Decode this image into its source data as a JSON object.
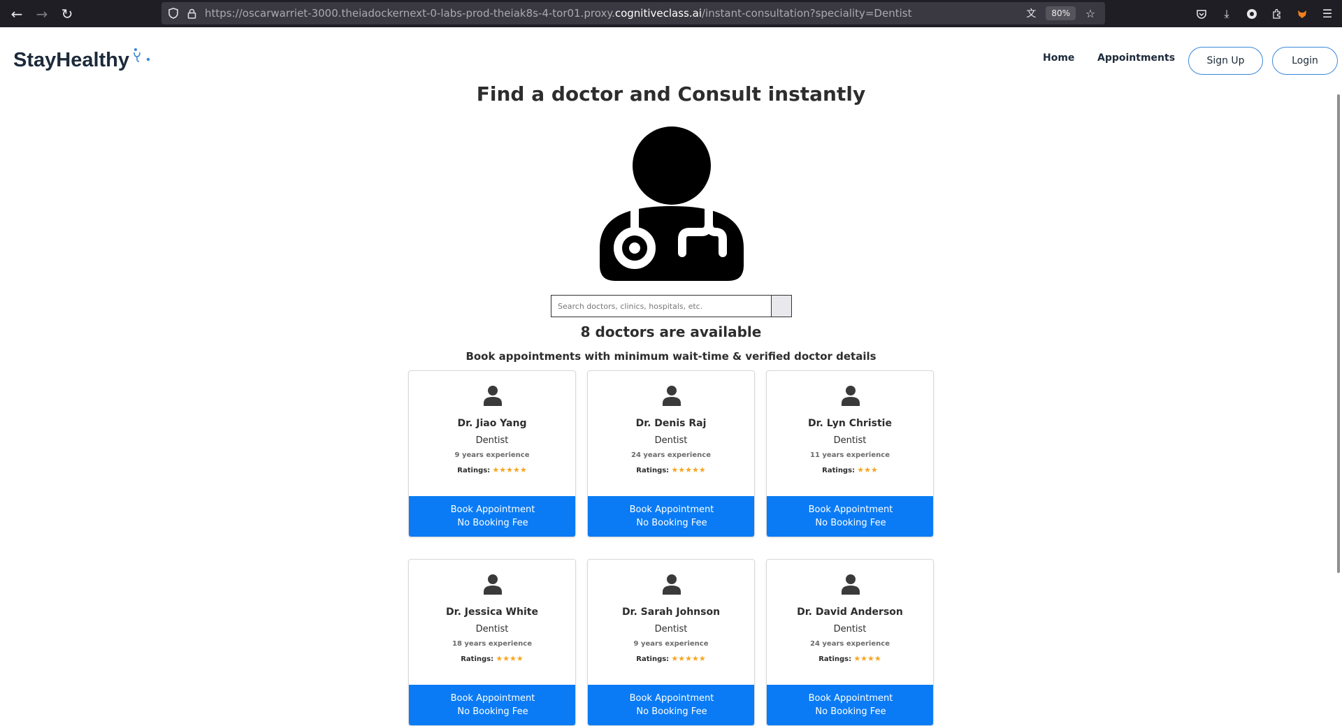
{
  "browser": {
    "url_prefix": "https://oscarwarriet-3000.theiadockernext-0-labs-prod-theiak8s-4-tor01.proxy.",
    "url_host": "cognitiveclass.ai",
    "url_suffix": "/instant-consultation?speciality=Dentist",
    "zoom": "80%"
  },
  "navbar": {
    "brand": "StayHealthy",
    "home": "Home",
    "appointments": "Appointments",
    "signup": "Sign Up",
    "login": "Login"
  },
  "main": {
    "title": "Find a doctor and Consult instantly",
    "search_placeholder": "Search doctors, clinics, hospitals, etc.",
    "count_text": "8 doctors are available",
    "subtitle": "Book appointments with minimum wait-time & verified doctor details"
  },
  "doctors": [
    {
      "name": "Dr. Jiao Yang",
      "speciality": "Dentist",
      "experience": "9 years experience",
      "ratings_label": "Ratings:",
      "stars": "★★★★★",
      "btn_line1": "Book Appointment",
      "btn_line2": "No Booking Fee"
    },
    {
      "name": "Dr. Denis Raj",
      "speciality": "Dentist",
      "experience": "24 years experience",
      "ratings_label": "Ratings:",
      "stars": "★★★★★",
      "btn_line1": "Book Appointment",
      "btn_line2": "No Booking Fee"
    },
    {
      "name": "Dr. Lyn Christie",
      "speciality": "Dentist",
      "experience": "11 years experience",
      "ratings_label": "Ratings:",
      "stars": "★★★",
      "btn_line1": "Book Appointment",
      "btn_line2": "No Booking Fee"
    },
    {
      "name": "Dr. Jessica White",
      "speciality": "Dentist",
      "experience": "18 years experience",
      "ratings_label": "Ratings:",
      "stars": "★★★★",
      "btn_line1": "Book Appointment",
      "btn_line2": "No Booking Fee"
    },
    {
      "name": "Dr. Sarah Johnson",
      "speciality": "Dentist",
      "experience": "9 years experience",
      "ratings_label": "Ratings:",
      "stars": "★★★★★",
      "btn_line1": "Book Appointment",
      "btn_line2": "No Booking Fee"
    },
    {
      "name": "Dr. David Anderson",
      "speciality": "Dentist",
      "experience": "24 years experience",
      "ratings_label": "Ratings:",
      "stars": "★★★★",
      "btn_line1": "Book Appointment",
      "btn_line2": "No Booking Fee"
    }
  ],
  "colors": {
    "accent": "#0a7bf5",
    "star": "#f5a623",
    "brand_text": "#1c2a3a"
  }
}
